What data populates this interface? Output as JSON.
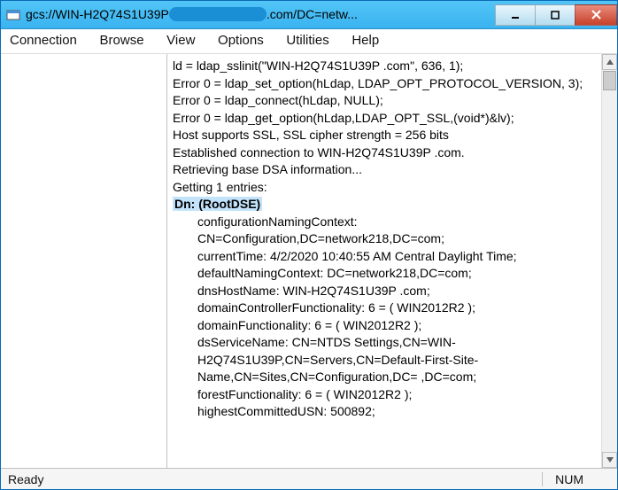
{
  "titlebar": {
    "prefix": "gcs://WIN-H2Q74S1U39P",
    "suffix": ".com/DC=netw..."
  },
  "menu": {
    "connection": "Connection",
    "browse": "Browse",
    "view": "View",
    "options": "Options",
    "utilities": "Utilities",
    "help": "Help"
  },
  "output": {
    "l0": "ld = ldap_sslinit(\"WIN-H2Q74S1U39P                         .com\", 636, 1);",
    "l1": "Error 0 = ldap_set_option(hLdap, LDAP_OPT_PROTOCOL_VERSION, 3);",
    "l2": "Error 0 = ldap_connect(hLdap, NULL);",
    "l3": "Error 0 = ldap_get_option(hLdap,LDAP_OPT_SSL,(void*)&lv);",
    "l4": "Host supports SSL, SSL cipher strength = 256 bits",
    "l5": "Established connection to WIN-H2Q74S1U39P                    .com.",
    "l6": "Retrieving base DSA information...",
    "l7": "Getting 1 entries:",
    "l8": "Dn: (RootDSE)",
    "l9": "configurationNamingContext: CN=Configuration,DC=network218,DC=com;",
    "l10": "currentTime: 4/2/2020 10:40:55 AM Central Daylight Time;",
    "l11": "defaultNamingContext: DC=network218,DC=com;",
    "l12": "dnsHostName: WIN-H2Q74S1U39P                             .com;",
    "l13": "domainControllerFunctionality: 6 = ( WIN2012R2 );",
    "l14": "domainFunctionality: 6 = ( WIN2012R2 );",
    "l15": "dsServiceName: CN=NTDS Settings,CN=WIN-H2Q74S1U39P,CN=Servers,CN=Default-First-Site-Name,CN=Sites,CN=Configuration,DC=              ,DC=com;",
    "l16": "forestFunctionality: 6 = ( WIN2012R2 );",
    "l17": "highestCommittedUSN: 500892;"
  },
  "statusbar": {
    "ready": "Ready",
    "num": "NUM"
  }
}
